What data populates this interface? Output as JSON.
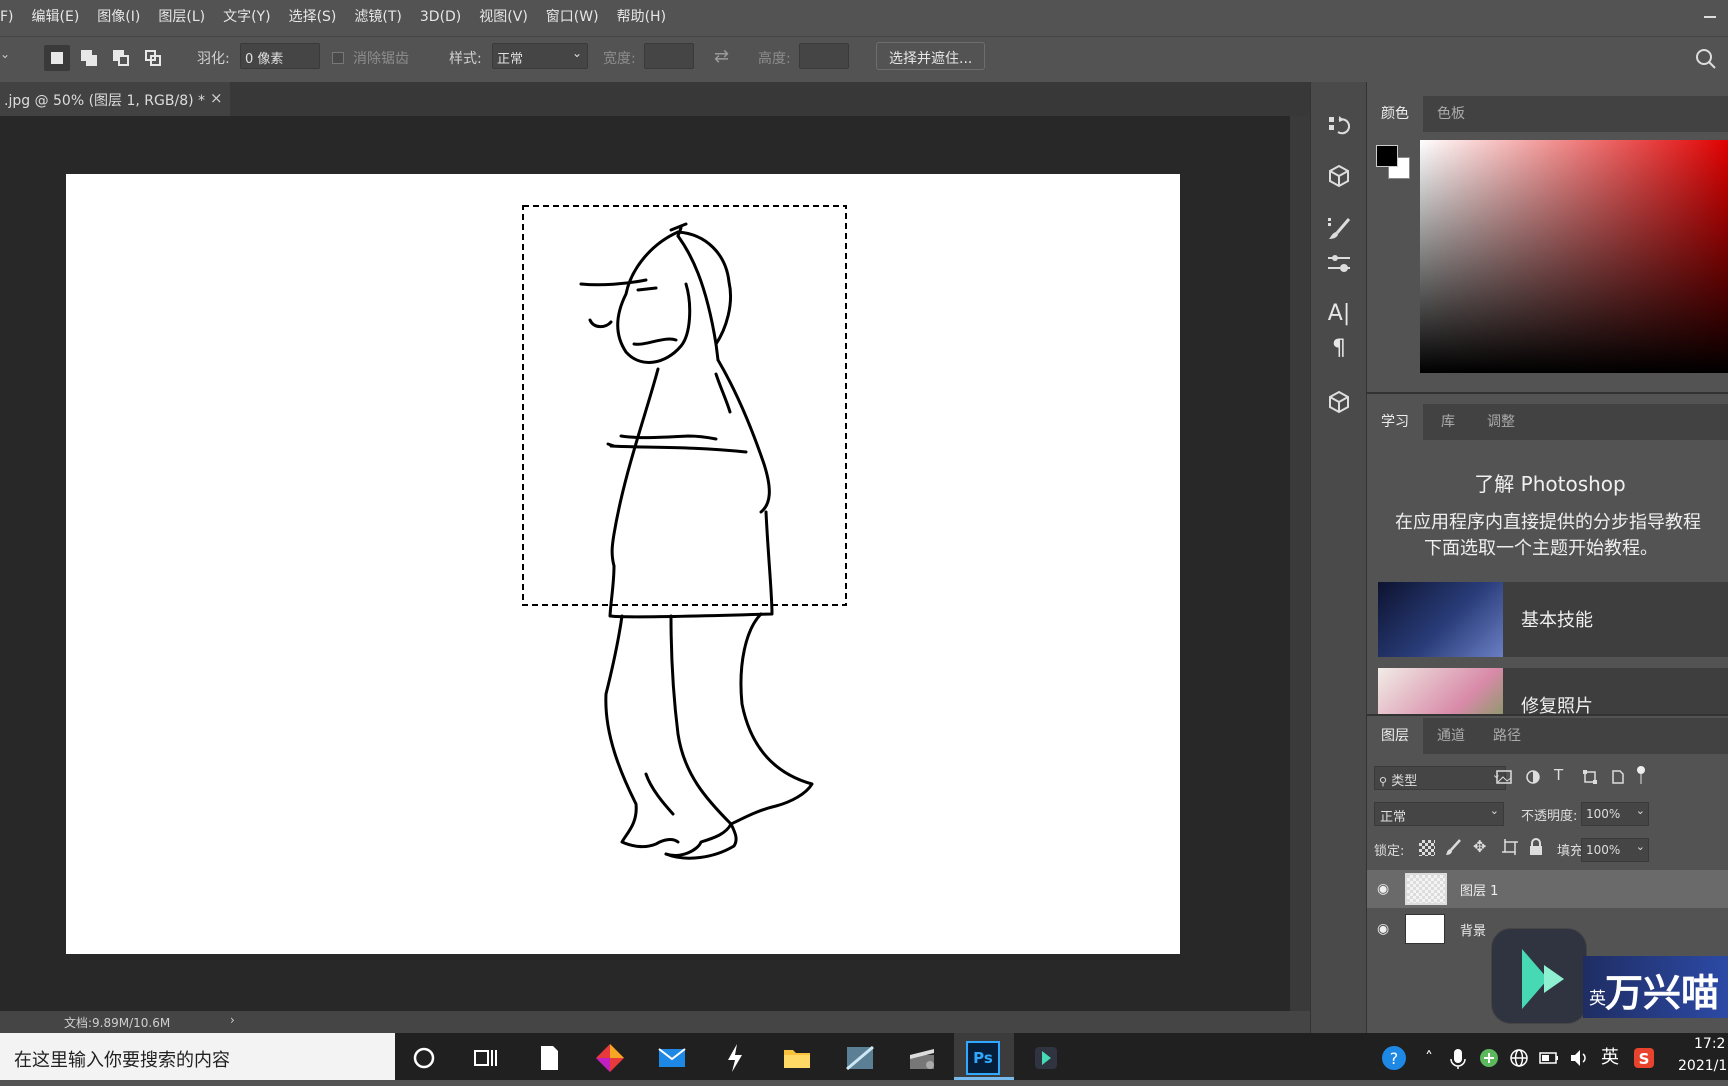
{
  "menubar": {
    "items": [
      "F)",
      "编辑(E)",
      "图像(I)",
      "图层(L)",
      "文字(Y)",
      "选择(S)",
      "滤镜(T)",
      "3D(D)",
      "视图(V)",
      "窗口(W)",
      "帮助(H)"
    ]
  },
  "options": {
    "feather_label": "羽化:",
    "feather_value": "0 像素",
    "antialias_label": "消除锯齿",
    "style_label": "样式:",
    "style_value": "正常",
    "width_label": "宽度:",
    "height_label": "高度:",
    "select_mask_button": "选择并遮住..."
  },
  "document": {
    "tab_title": ".jpg @ 50% (图层 1, RGB/8) *",
    "close_glyph": "×",
    "status": "文档:9.89M/10.6M",
    "status_arrow": "›"
  },
  "color_panel": {
    "tabs": [
      "颜色",
      "色板"
    ],
    "foreground": "#000000",
    "background": "#ffffff",
    "hue": "#e00000"
  },
  "learn_panel": {
    "tabs": [
      "学习",
      "库",
      "调整"
    ],
    "title": "了解 Photoshop",
    "desc_line1": "在应用程序内直接提供的分步指导教程",
    "desc_line2": "下面选取一个主题开始教程。",
    "topics": [
      "基本技能",
      "修复照片"
    ]
  },
  "layers_panel": {
    "tabs": [
      "图层",
      "通道",
      "路径"
    ],
    "filter_label": "类型",
    "blend_mode": "正常",
    "opacity_label": "不透明度:",
    "opacity_value": "100%",
    "lock_label": "锁定:",
    "fill_label": "填充:",
    "fill_value": "100%",
    "layers": [
      {
        "name": "图层 1",
        "selected": true
      },
      {
        "name": "背景",
        "selected": false
      }
    ]
  },
  "overlay": {
    "watermark_text": "万兴喵",
    "ime_text": "英"
  },
  "taskbar": {
    "search_placeholder": "在这里输入你要搜索的内容",
    "ps_label": "Ps",
    "ime_indicator": "英",
    "time": "17:2",
    "date": "2021/1"
  },
  "icons": [
    "history-icon",
    "3d-object-icon",
    "brush-settings-icon",
    "adjustments-icon",
    "character-icon",
    "paragraph-icon",
    "cube-icon"
  ]
}
